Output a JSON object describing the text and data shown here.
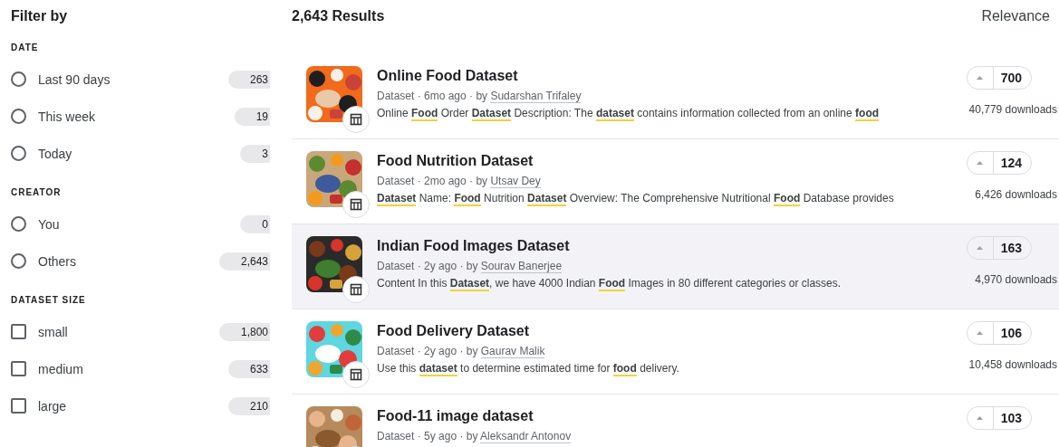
{
  "sidebar": {
    "title": "Filter by",
    "groups": [
      {
        "heading": "DATE",
        "kind": "radio",
        "options": [
          {
            "label": "Last 90 days",
            "count": "263",
            "checked": false
          },
          {
            "label": "This week",
            "count": "19",
            "checked": false
          },
          {
            "label": "Today",
            "count": "3",
            "checked": false
          }
        ]
      },
      {
        "heading": "CREATOR",
        "kind": "radio",
        "options": [
          {
            "label": "You",
            "count": "0",
            "checked": false
          },
          {
            "label": "Others",
            "count": "2,643",
            "checked": false
          }
        ]
      },
      {
        "heading": "DATASET SIZE",
        "kind": "checkbox",
        "options": [
          {
            "label": "small",
            "count": "1,800",
            "checked": false
          },
          {
            "label": "medium",
            "count": "633",
            "checked": false
          },
          {
            "label": "large",
            "count": "210",
            "checked": false
          }
        ]
      }
    ]
  },
  "results": {
    "count": "2,643 Results",
    "sort": "Relevance",
    "items": [
      {
        "title": "Online Food Dataset",
        "meta": "Dataset · 6mo ago · by",
        "author": "Sudarshan Trifaley",
        "description": "Online **Food** Order **Dataset** Description: The **dataset** contains information collected from an online **food**",
        "votes": "700",
        "downloads": "40,779 downloads",
        "highlighted": false
      },
      {
        "title": "Food Nutrition Dataset",
        "meta": "Dataset · 2mo ago · by",
        "author": "Utsav Dey",
        "description": "**Dataset** Name: **Food** Nutrition **Dataset** Overview: The Comprehensive Nutritional **Food** Database provides",
        "votes": "124",
        "downloads": "6,426 downloads",
        "highlighted": false
      },
      {
        "title": "Indian Food Images Dataset",
        "meta": "Dataset · 2y ago · by",
        "author": "Sourav Banerjee",
        "description": "Content In this **Dataset**, we have 4000 Indian **Food** Images in 80 different categories or classes.",
        "votes": "163",
        "downloads": "4,970 downloads",
        "highlighted": true
      },
      {
        "title": "Food Delivery Dataset",
        "meta": "Dataset · 2y ago · by",
        "author": "Gaurav Malik",
        "description": "Use this **dataset** to determine estimated time for **food** delivery.",
        "votes": "106",
        "downloads": "10,458 downloads",
        "highlighted": false
      },
      {
        "title": "Food-11 image dataset",
        "meta": "Dataset · 5y ago · by",
        "author": "Aleksandr Antonov",
        "votes": "103",
        "highlighted": false
      }
    ]
  }
}
